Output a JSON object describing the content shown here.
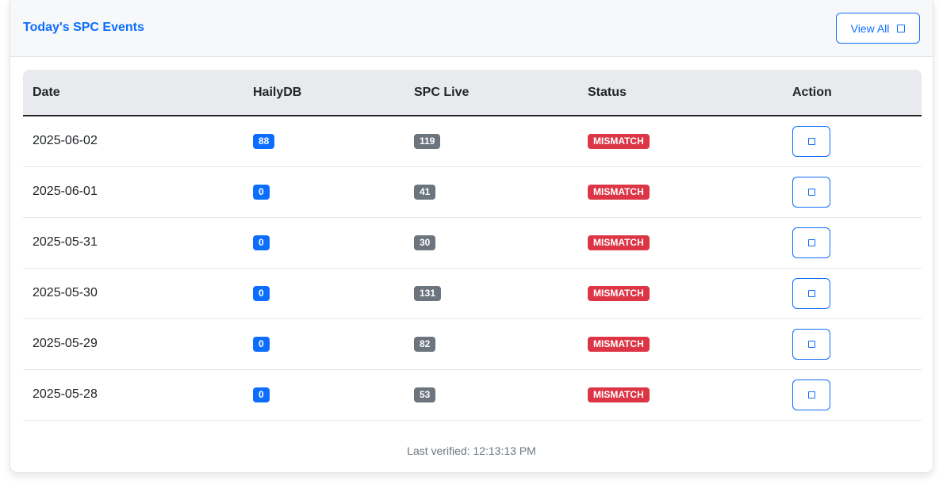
{
  "header": {
    "title": "Today's SPC Events",
    "view_all_label": "View All"
  },
  "table": {
    "columns": [
      "Date",
      "HailyDB",
      "SPC Live",
      "Status",
      "Action"
    ],
    "rows": [
      {
        "date": "2025-06-02",
        "hailydb": "88",
        "spc_live": "119",
        "status": "MISMATCH"
      },
      {
        "date": "2025-06-01",
        "hailydb": "0",
        "spc_live": "41",
        "status": "MISMATCH"
      },
      {
        "date": "2025-05-31",
        "hailydb": "0",
        "spc_live": "30",
        "status": "MISMATCH"
      },
      {
        "date": "2025-05-30",
        "hailydb": "0",
        "spc_live": "131",
        "status": "MISMATCH"
      },
      {
        "date": "2025-05-29",
        "hailydb": "0",
        "spc_live": "82",
        "status": "MISMATCH"
      },
      {
        "date": "2025-05-28",
        "hailydb": "0",
        "spc_live": "53",
        "status": "MISMATCH"
      }
    ]
  },
  "footer": {
    "last_verified": "Last verified: 12:13:13 PM"
  },
  "icons": {
    "view_all_icon": "square-icon",
    "row_action_icon": "square-icon"
  },
  "colors": {
    "accent": "#0d6efd",
    "count_badge": "#6c757d",
    "mismatch": "#dc3545"
  }
}
